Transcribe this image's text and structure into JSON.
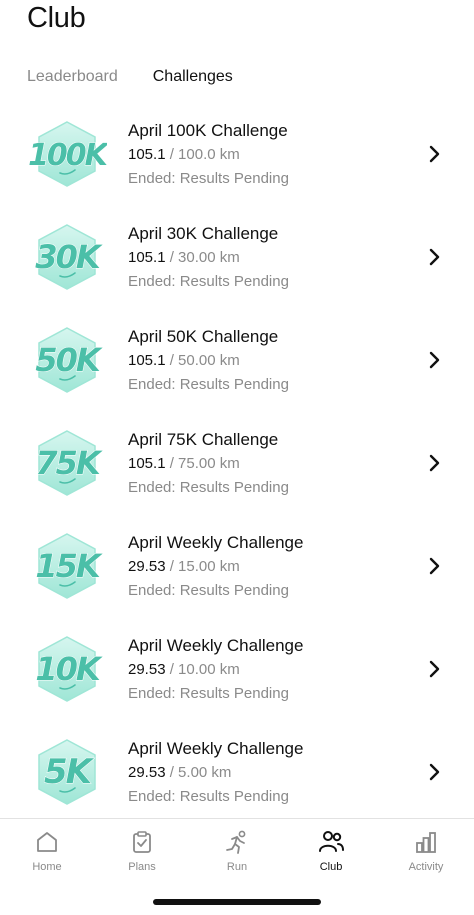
{
  "header": {
    "title": "Club"
  },
  "tabs": [
    {
      "label": "Leaderboard",
      "active": false
    },
    {
      "label": "Challenges",
      "active": true
    }
  ],
  "colors": {
    "badge_light": "#d6f6ef",
    "badge_mid": "#9fe6d6",
    "badge_text": "#4bbfa8",
    "badge_stroke": "#ffffff"
  },
  "challenges": [
    {
      "badge": "100K",
      "title": "April 100K Challenge",
      "current": "105.1",
      "target": "/ 100.0 km",
      "status": "Ended: Results Pending"
    },
    {
      "badge": "30K",
      "title": "April 30K Challenge",
      "current": "105.1",
      "target": "/ 30.00 km",
      "status": "Ended: Results Pending"
    },
    {
      "badge": "50K",
      "title": "April 50K Challenge",
      "current": "105.1",
      "target": "/ 50.00 km",
      "status": "Ended: Results Pending"
    },
    {
      "badge": "75K",
      "title": "April 75K Challenge",
      "current": "105.1",
      "target": "/ 75.00 km",
      "status": "Ended: Results Pending"
    },
    {
      "badge": "15K",
      "title": "April Weekly Challenge",
      "current": "29.53",
      "target": "/ 15.00 km",
      "status": "Ended: Results Pending"
    },
    {
      "badge": "10K",
      "title": "April Weekly Challenge",
      "current": "29.53",
      "target": "/ 10.00 km",
      "status": "Ended: Results Pending"
    },
    {
      "badge": "5K",
      "title": "April Weekly Challenge",
      "current": "29.53",
      "target": "/ 5.00 km",
      "status": "Ended: Results Pending"
    }
  ],
  "nav": [
    {
      "label": "Home",
      "icon": "home-icon",
      "active": false
    },
    {
      "label": "Plans",
      "icon": "plans-icon",
      "active": false
    },
    {
      "label": "Run",
      "icon": "run-icon",
      "active": false
    },
    {
      "label": "Club",
      "icon": "club-icon",
      "active": true
    },
    {
      "label": "Activity",
      "icon": "activity-icon",
      "active": false
    }
  ]
}
